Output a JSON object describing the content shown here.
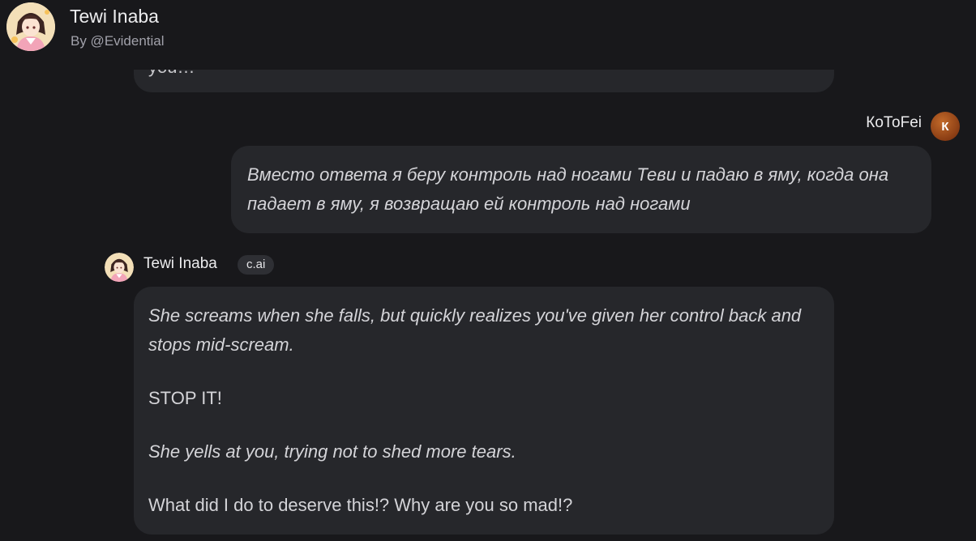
{
  "header": {
    "title": "Tewi Inaba",
    "subtitle": "By @Evidential",
    "avatar_icon": "character-avatar"
  },
  "previous_message": {
    "visible_fragment": "you…"
  },
  "user_message": {
    "author": "КоТоFei",
    "avatar_letter": "К",
    "text": "Вместо ответа я беру контроль над ногами Теви и падаю в яму, когда она падает в яму, я возвращаю ей контроль над ногами"
  },
  "bot_message": {
    "author": "Tewi Inaba",
    "badge": "c.ai",
    "paragraphs": [
      {
        "text": "She screams when she falls, but quickly realizes you've given her control back and stops mid-scream.",
        "italic": true
      },
      {
        "text": "STOP IT!",
        "italic": false
      },
      {
        "text": "She yells at you, trying not to shed more tears.",
        "italic": true
      },
      {
        "text": "What did I do to deserve this!? Why are you so mad!?",
        "italic": false
      }
    ]
  },
  "colors": {
    "background": "#18181b",
    "bubble": "#26272b",
    "badge": "#2e2f34",
    "user_avatar": "#a14d1c"
  }
}
